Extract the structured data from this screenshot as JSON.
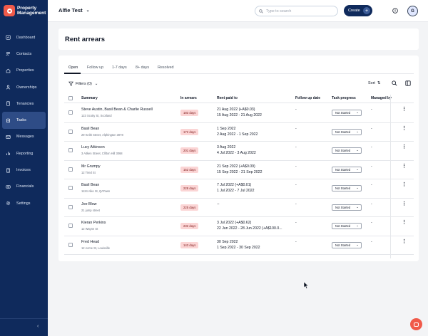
{
  "brand": {
    "line1": "Property",
    "line2": "Management",
    "logo_color": "#f05a4a"
  },
  "sidebar": {
    "items": [
      {
        "label": "Dashboard",
        "icon": "dashboard-icon"
      },
      {
        "label": "Contacts",
        "icon": "contacts-icon"
      },
      {
        "label": "Properties",
        "icon": "properties-icon"
      },
      {
        "label": "Ownerships",
        "icon": "ownerships-icon"
      },
      {
        "label": "Tenancies",
        "icon": "tenancies-icon"
      },
      {
        "label": "Tasks",
        "icon": "tasks-icon",
        "active": true
      },
      {
        "label": "Messages",
        "icon": "messages-icon"
      },
      {
        "label": "Reporting",
        "icon": "reporting-icon"
      },
      {
        "label": "Invoices",
        "icon": "invoices-icon"
      },
      {
        "label": "Financials",
        "icon": "financials-icon"
      },
      {
        "label": "Settings",
        "icon": "settings-icon"
      }
    ],
    "collapse_glyph": "‹"
  },
  "topbar": {
    "account_name": "Alfie Test",
    "search_placeholder": "Type to search",
    "create_label": "Create",
    "avatar_initial": "G"
  },
  "page": {
    "title": "Rent arrears"
  },
  "tabs": [
    "Open",
    "Follow up",
    "1-7 days",
    "8+ days",
    "Resolved"
  ],
  "toolbar": {
    "filters_label": "Filters (0)",
    "sort_label": "Sort"
  },
  "table": {
    "headers": {
      "summary": "Summary",
      "in_arrears": "In arrears",
      "rent_paid_to": "Rent paid to",
      "follow_up_date": "Follow up date",
      "task_progress": "Task progress",
      "managed_by": "Managed by"
    },
    "rows": [
      {
        "name": "Steve Austin, Basil Bean & Charlie Russell",
        "address": "123 Scotty St, Scotland",
        "arrears": "183 days",
        "paid1": "21 Aug 2022 (+A$0.03)",
        "paid2": "15 Aug 2022 - 21 Aug 2022",
        "follow": "-",
        "task": "Not Started",
        "managed": "-"
      },
      {
        "name": "Basil Bean",
        "address": "29 Keith Street, Alphington 3078",
        "arrears": "172 days",
        "paid1": "1 Sep 2022",
        "paid2": "2 Aug 2022 - 1 Sep 2022",
        "follow": "-",
        "task": "Not Started",
        "managed": "-"
      },
      {
        "name": "Lucy Atkinson",
        "address": "3 Aitken Street, Clifton Hill 3068",
        "arrears": "201 days",
        "paid1": "3 Aug 2022",
        "paid2": "4 Jul 2022 - 3 Aug 2022",
        "follow": "-",
        "task": "Not Started",
        "managed": "-"
      },
      {
        "name": "Mr Grumpy",
        "address": "12 Tired St",
        "arrears": "152 days",
        "paid1": "21 Sep 2022 (+A$0.09)",
        "paid2": "15 Sep 2022 - 21 Sep 2022",
        "follow": "-",
        "task": "Not Started",
        "managed": "-"
      },
      {
        "name": "Basil Bean",
        "address": "1124 Alko St, QATown",
        "arrears": "228 days",
        "paid1": "7 Jul 2022 (+A$0.01)",
        "paid2": "1 Jul 2022 - 7 Jul 2022",
        "follow": "-",
        "task": "Not Started",
        "managed": "-"
      },
      {
        "name": "Joe Blow",
        "address": "21 jump street",
        "arrears": "225 days",
        "paid1": "--",
        "paid2": "",
        "follow": "-",
        "task": "Not Started",
        "managed": "-"
      },
      {
        "name": "Kieran Perkins",
        "address": "12 Wayne St",
        "arrears": "232 days",
        "paid1": "3 Jul 2022 (+A$0.62)",
        "paid2": "22 Jun 2022 - 28 Jun 2022 (+A$100.0...",
        "follow": "-",
        "task": "Not Started",
        "managed": "-"
      },
      {
        "name": "Fred Head",
        "address": "12 Acme St, Louisville",
        "arrears": "143 days",
        "paid1": "30 Sep 2022",
        "paid2": "1 Sep 2022 - 30 Sep 2022",
        "follow": "-",
        "task": "Not Started",
        "managed": "-"
      }
    ]
  },
  "colors": {
    "sidebar": "#0f2a5c",
    "arrears_badge": "#fbd5d5",
    "accent": "#f05a4a"
  }
}
